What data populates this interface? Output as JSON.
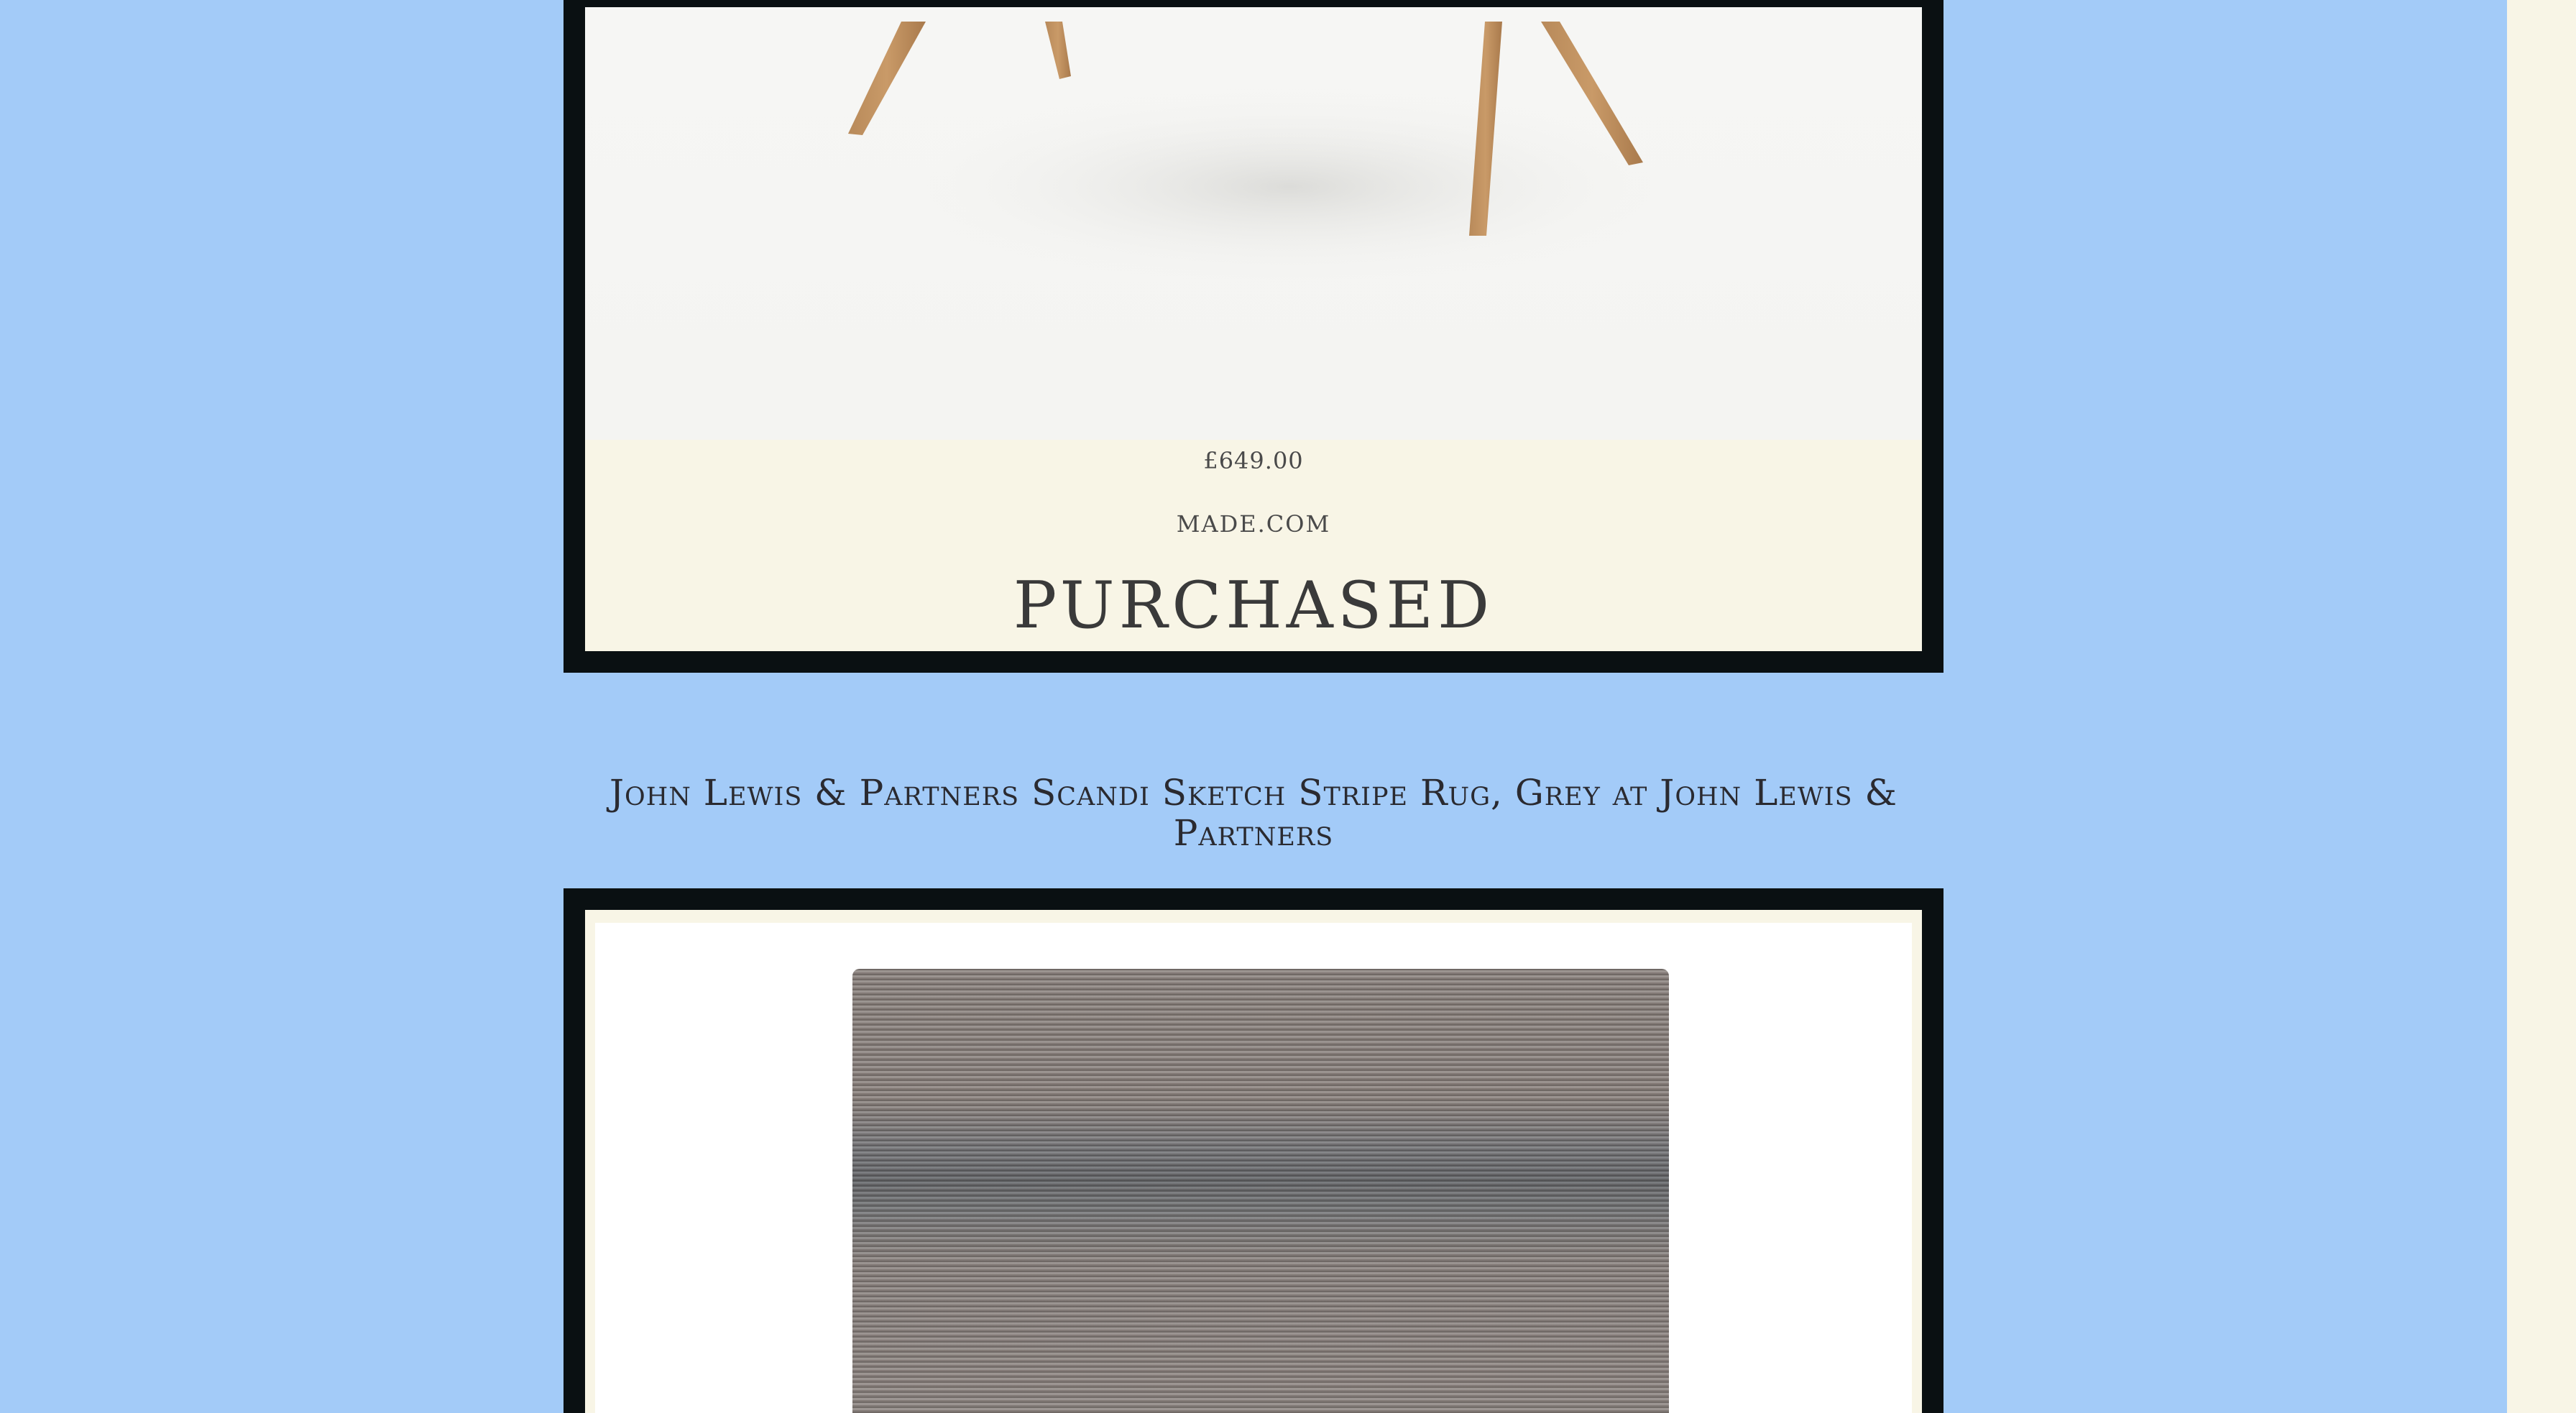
{
  "items": [
    {
      "price": "£649.00",
      "store": "MADE.COM",
      "status": "PURCHASED",
      "image_alt": "Wooden-legged chair product photo"
    },
    {
      "title": "John Lewis & Partners Scandi Sketch Stripe Rug, Grey at John Lewis & Partners",
      "image_alt": "Grey striped rug product photo"
    }
  ],
  "colors": {
    "page_background": "#a3cbf8",
    "card_frame": "#0a1012",
    "card_panel": "#f8f5e6",
    "text": "#3a3a3a"
  }
}
